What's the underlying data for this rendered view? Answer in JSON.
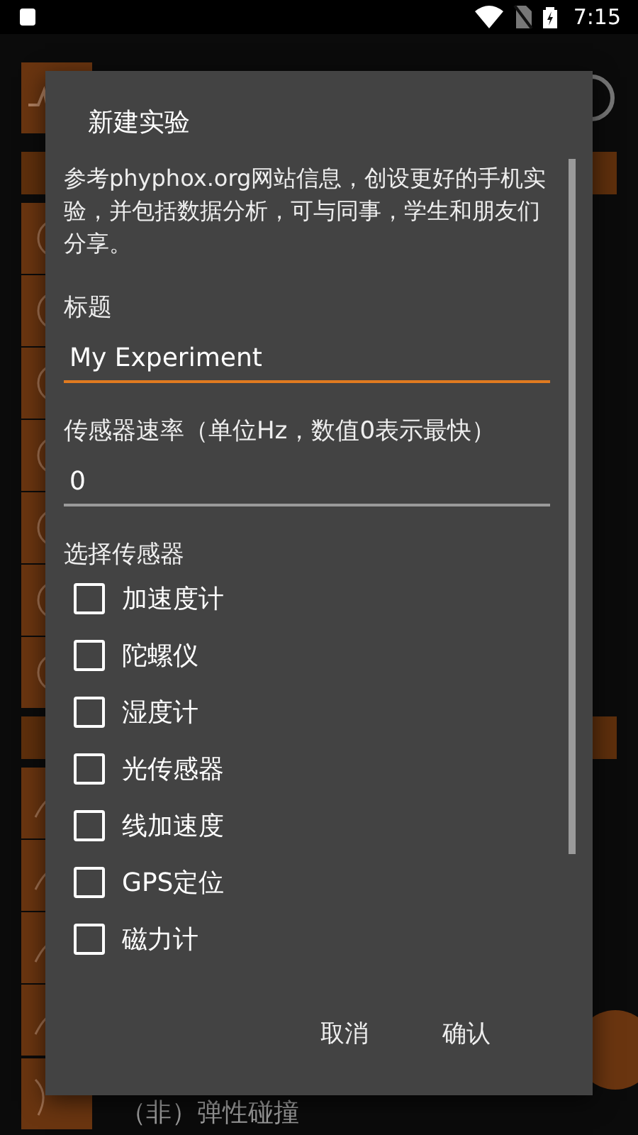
{
  "status_bar": {
    "time": "7:15"
  },
  "background": {
    "last_item": "（非）弹性碰撞"
  },
  "dialog": {
    "title": "新建实验",
    "description": "参考phyphox.org网站信息，创设更好的手机实验，并包括数据分析，可与同事，学生和朋友们分享。",
    "fields": [
      {
        "label": "标题",
        "value": "My Experiment",
        "focused": true
      },
      {
        "label": "传感器速率（单位Hz，数值0表示最快）",
        "value": "0",
        "focused": false
      }
    ],
    "sensors_label": "选择传感器",
    "sensors": [
      {
        "label": "加速度计",
        "checked": false
      },
      {
        "label": "陀螺仪",
        "checked": false
      },
      {
        "label": "湿度计",
        "checked": false
      },
      {
        "label": "光传感器",
        "checked": false
      },
      {
        "label": "线加速度",
        "checked": false
      },
      {
        "label": "GPS定位",
        "checked": false
      },
      {
        "label": "磁力计",
        "checked": false
      }
    ],
    "buttons": [
      "取消",
      "确认"
    ]
  }
}
